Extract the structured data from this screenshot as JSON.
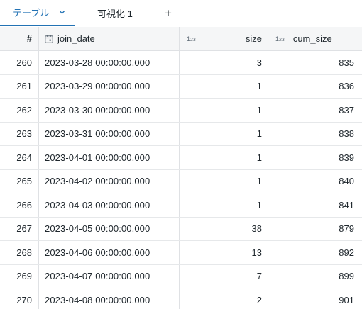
{
  "tabs": {
    "table_label": "テーブル",
    "viz_label": "可視化 1",
    "add_label": "+"
  },
  "columns": {
    "index": "#",
    "join_date": "join_date",
    "size": "size",
    "cum_size": "cum_size",
    "int_type": "1 2 3"
  },
  "rows": [
    {
      "num": "260",
      "join_date": "2023-03-28 00:00:00.000",
      "size": "3",
      "cum_size": "835"
    },
    {
      "num": "261",
      "join_date": "2023-03-29 00:00:00.000",
      "size": "1",
      "cum_size": "836"
    },
    {
      "num": "262",
      "join_date": "2023-03-30 00:00:00.000",
      "size": "1",
      "cum_size": "837"
    },
    {
      "num": "263",
      "join_date": "2023-03-31 00:00:00.000",
      "size": "1",
      "cum_size": "838"
    },
    {
      "num": "264",
      "join_date": "2023-04-01 00:00:00.000",
      "size": "1",
      "cum_size": "839"
    },
    {
      "num": "265",
      "join_date": "2023-04-02 00:00:00.000",
      "size": "1",
      "cum_size": "840"
    },
    {
      "num": "266",
      "join_date": "2023-04-03 00:00:00.000",
      "size": "1",
      "cum_size": "841"
    },
    {
      "num": "267",
      "join_date": "2023-04-05 00:00:00.000",
      "size": "38",
      "cum_size": "879"
    },
    {
      "num": "268",
      "join_date": "2023-04-06 00:00:00.000",
      "size": "13",
      "cum_size": "892"
    },
    {
      "num": "269",
      "join_date": "2023-04-07 00:00:00.000",
      "size": "7",
      "cum_size": "899"
    },
    {
      "num": "270",
      "join_date": "2023-04-08 00:00:00.000",
      "size": "2",
      "cum_size": "901"
    }
  ]
}
